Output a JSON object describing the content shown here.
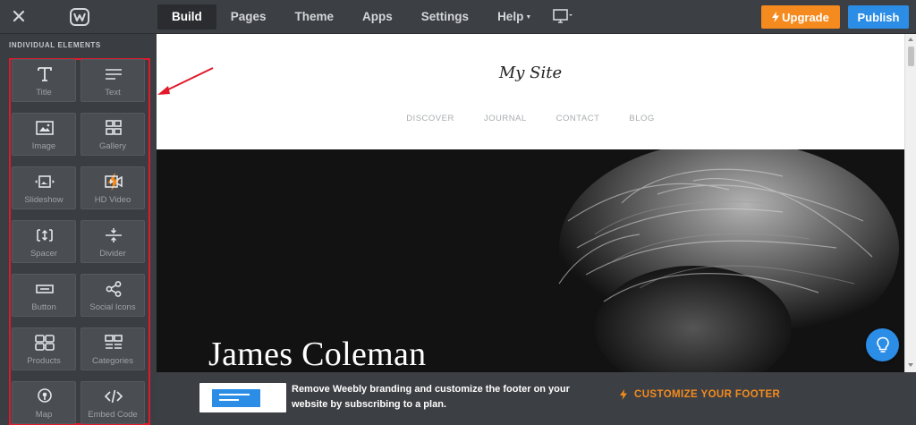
{
  "topbar": {
    "nav": [
      {
        "label": "Build",
        "active": true
      },
      {
        "label": "Pages"
      },
      {
        "label": "Theme"
      },
      {
        "label": "Apps"
      },
      {
        "label": "Settings"
      },
      {
        "label": "Help"
      }
    ],
    "upgrade_label": "Upgrade",
    "publish_label": "Publish"
  },
  "sidebar": {
    "section_title": "INDIVIDUAL ELEMENTS",
    "elements": [
      {
        "label": "Title",
        "icon": "title-icon"
      },
      {
        "label": "Text",
        "icon": "text-icon"
      },
      {
        "label": "Image",
        "icon": "image-icon"
      },
      {
        "label": "Gallery",
        "icon": "gallery-icon"
      },
      {
        "label": "Slideshow",
        "icon": "slideshow-icon"
      },
      {
        "label": "HD Video",
        "icon": "video-icon"
      },
      {
        "label": "Spacer",
        "icon": "spacer-icon"
      },
      {
        "label": "Divider",
        "icon": "divider-icon"
      },
      {
        "label": "Button",
        "icon": "button-icon"
      },
      {
        "label": "Social Icons",
        "icon": "share-icon"
      },
      {
        "label": "Products",
        "icon": "products-icon"
      },
      {
        "label": "Categories",
        "icon": "categories-icon"
      },
      {
        "label": "Map",
        "icon": "map-pin-icon"
      },
      {
        "label": "Embed Code",
        "icon": "code-icon"
      }
    ]
  },
  "site": {
    "title": "My Site",
    "nav": [
      "DISCOVER",
      "JOURNAL",
      "CONTACT",
      "BLOG"
    ],
    "hero_name": "James Coleman"
  },
  "footer": {
    "promo_line1": "Remove Weebly branding and customize the footer on your",
    "promo_line2": "website by subscribing to a plan.",
    "customize_label": "CUSTOMIZE YOUR FOOTER"
  },
  "colors": {
    "accent_orange": "#f58b1f",
    "accent_blue": "#2b8de6",
    "highlight_red": "#e0192b"
  }
}
